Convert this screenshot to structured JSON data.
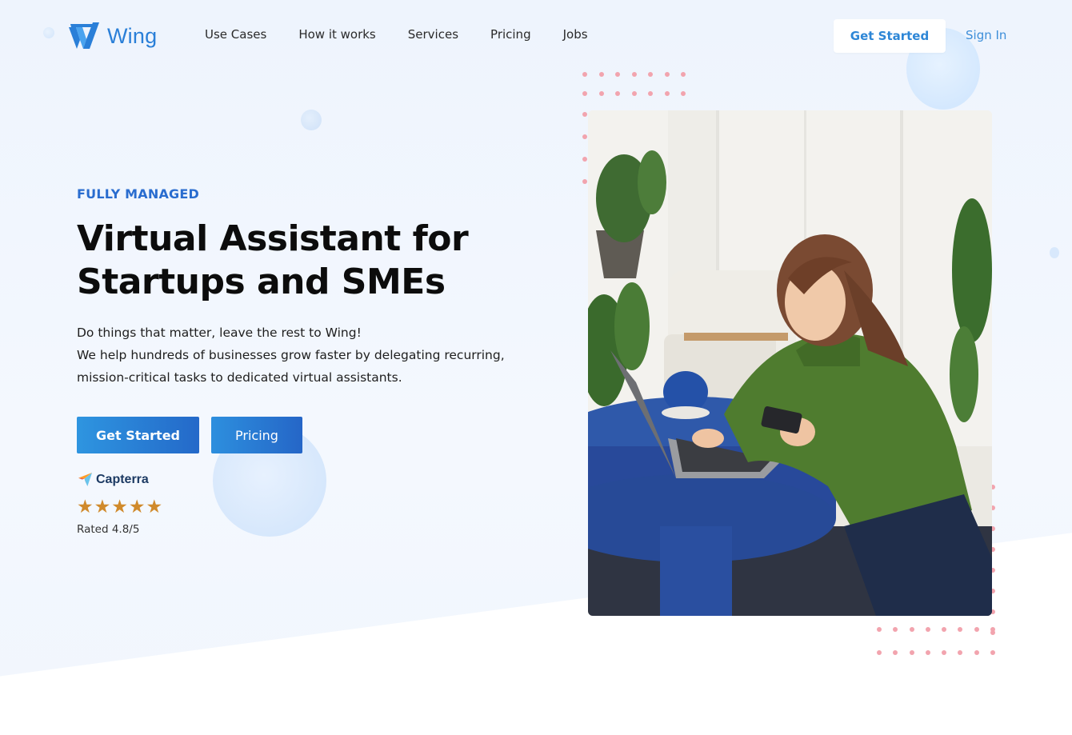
{
  "brand": {
    "name": "Wing",
    "accent": "#2a7fd8"
  },
  "nav": {
    "items": [
      "Use Cases",
      "How it works",
      "Services",
      "Pricing",
      "Jobs"
    ],
    "cta_label": "Get Started",
    "signin_label": "Sign In"
  },
  "hero": {
    "eyebrow": "FULLY MANAGED",
    "headline": [
      "Virtual Assistant for",
      "Startups and SMEs"
    ],
    "body": [
      "Do things that matter, leave the rest to Wing!",
      "We help hundreds of businesses grow faster by delegating recurring,",
      "mission-critical tasks to dedicated virtual assistants."
    ],
    "primary_button": "Get Started",
    "secondary_button": "Pricing",
    "rating": {
      "source": "Capterra",
      "stars": 5,
      "text": "Rated 4.8/5"
    }
  },
  "image": {
    "icon": "photo-woman-laptop",
    "colors": {
      "sweater": "#4d7a2e",
      "table": "#2d55a4",
      "backdrop": "#f2f1ed"
    }
  },
  "colors": {
    "primary_blue": "#2a6dcf",
    "dot_pink": "#f2a4ae",
    "star_orange": "#d08a2b"
  }
}
